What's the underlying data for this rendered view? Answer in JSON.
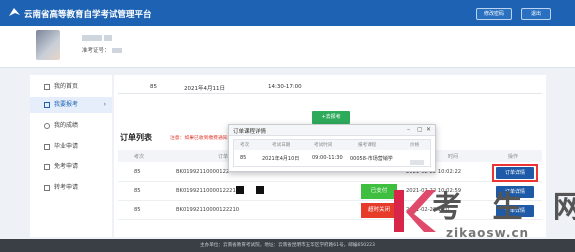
{
  "header": {
    "title": "云南省高等教育自学考试管理平台",
    "change_password": "修改密码",
    "logout": "退出"
  },
  "profile": {
    "ticket_label": "准考证号："
  },
  "sidebar": {
    "items": [
      {
        "label": "我的首页",
        "icon": "home-icon"
      },
      {
        "label": "我要报考",
        "icon": "document-icon",
        "active": true
      },
      {
        "label": "我的成绩",
        "icon": "user-icon"
      },
      {
        "label": "毕业申请",
        "icon": "graduation-icon"
      },
      {
        "label": "免考申请",
        "icon": "document-icon"
      },
      {
        "label": "转考申请",
        "icon": "document-icon"
      }
    ]
  },
  "top_row": {
    "code": "85",
    "date": "2021年4月11日",
    "time": "14:30-17:00"
  },
  "add_button": "去报考",
  "order_list": {
    "title": "订单列表",
    "notice": "注意：如果已收到缴费通知",
    "columns": [
      "考次",
      "订单",
      "时间",
      "操作"
    ],
    "rows": [
      {
        "code": "85",
        "order": "BK01992110000122",
        "status": "",
        "time": "2021-02-22 10:02:22",
        "action": "订单详情"
      },
      {
        "code": "85",
        "order": "BK01992110000122210",
        "status": "已支付",
        "time": "2021-02-22 10:02:59",
        "action": "订单详情"
      },
      {
        "code": "85",
        "order": "BK01992110000122210",
        "status": "超时关闭",
        "time": "2021-02-22 10:0",
        "action": "订单详情"
      }
    ]
  },
  "modal": {
    "title": "订单课程详情",
    "columns": [
      "考次",
      "考试日期",
      "考试时间",
      "报考课程",
      "价格"
    ],
    "row": {
      "code": "85",
      "date": "2021年4月10日",
      "time": "09:00-11:30",
      "course": "00058-市场营销学"
    }
  },
  "footer": "主办单位：云南省教育考试院，地址：云南省昆明市五华区学府路61号，邮编650223",
  "watermark": {
    "chars": "考 生 网",
    "url": "zikaosw.cn"
  },
  "colors": {
    "brand": "#1e63b3",
    "paid": "#3fbf3f",
    "closed": "#e63a2a",
    "highlight": "#e33333"
  }
}
